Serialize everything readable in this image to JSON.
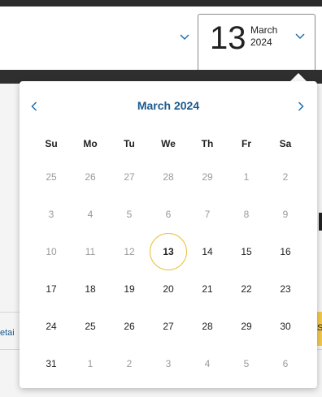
{
  "date_picker": {
    "day": "13",
    "month": "March",
    "year": "2024"
  },
  "under_content": {
    "left_text": "etai",
    "right_text": "S"
  },
  "calendar": {
    "title": "March 2024",
    "weekdays": [
      "Su",
      "Mo",
      "Tu",
      "We",
      "Th",
      "Fr",
      "Sa"
    ],
    "weeks": [
      [
        {
          "d": "25",
          "m": true
        },
        {
          "d": "26",
          "m": true
        },
        {
          "d": "27",
          "m": true
        },
        {
          "d": "28",
          "m": true
        },
        {
          "d": "29",
          "m": true
        },
        {
          "d": "1",
          "m": true
        },
        {
          "d": "2",
          "m": true
        }
      ],
      [
        {
          "d": "3",
          "m": true
        },
        {
          "d": "4",
          "m": true
        },
        {
          "d": "5",
          "m": true
        },
        {
          "d": "6",
          "m": true
        },
        {
          "d": "7",
          "m": true
        },
        {
          "d": "8",
          "m": true
        },
        {
          "d": "9",
          "m": true
        }
      ],
      [
        {
          "d": "10",
          "m": true
        },
        {
          "d": "11",
          "m": true
        },
        {
          "d": "12",
          "m": true
        },
        {
          "d": "13",
          "m": false,
          "today": true
        },
        {
          "d": "14",
          "m": false
        },
        {
          "d": "15",
          "m": false
        },
        {
          "d": "16",
          "m": false
        }
      ],
      [
        {
          "d": "17",
          "m": false
        },
        {
          "d": "18",
          "m": false
        },
        {
          "d": "19",
          "m": false
        },
        {
          "d": "20",
          "m": false
        },
        {
          "d": "21",
          "m": false
        },
        {
          "d": "22",
          "m": false
        },
        {
          "d": "23",
          "m": false
        }
      ],
      [
        {
          "d": "24",
          "m": false
        },
        {
          "d": "25",
          "m": false
        },
        {
          "d": "26",
          "m": false
        },
        {
          "d": "27",
          "m": false
        },
        {
          "d": "28",
          "m": false
        },
        {
          "d": "29",
          "m": false
        },
        {
          "d": "30",
          "m": false
        }
      ],
      [
        {
          "d": "31",
          "m": false
        },
        {
          "d": "1",
          "m": true
        },
        {
          "d": "2",
          "m": true
        },
        {
          "d": "3",
          "m": true
        },
        {
          "d": "4",
          "m": true
        },
        {
          "d": "5",
          "m": true
        },
        {
          "d": "6",
          "m": true
        }
      ]
    ]
  },
  "icons": {
    "prev": "chevron-left-icon",
    "next": "chevron-right-icon",
    "dropdown": "chevron-down-icon"
  },
  "colors": {
    "accent": "#1f6fb0",
    "title": "#1b5a8e",
    "today_ring": "#e8c23a",
    "muted": "#9a9a9a"
  }
}
